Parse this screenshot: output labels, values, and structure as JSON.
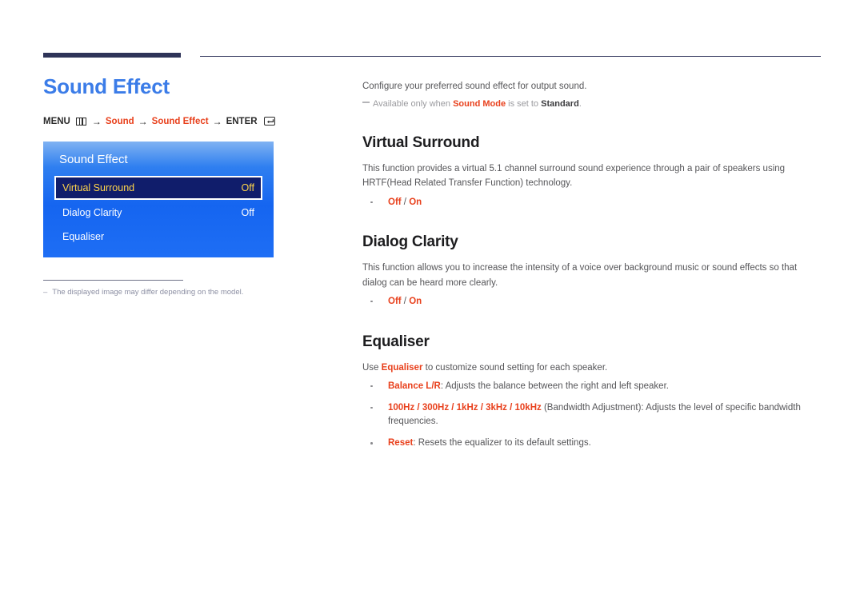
{
  "header": {
    "rule_color": "#2e3458"
  },
  "left": {
    "page_title": "Sound Effect",
    "breadcrumb": {
      "menu_label": "MENU",
      "menu_icon": "menu-grid-icon",
      "arrow": "→",
      "step1": "Sound",
      "step2": "Sound Effect",
      "enter_label": "ENTER",
      "enter_icon": "enter-key-icon"
    },
    "osd": {
      "title": "Sound Effect",
      "rows": [
        {
          "label": "Virtual Surround",
          "value": "Off",
          "selected": true
        },
        {
          "label": "Dialog Clarity",
          "value": "Off",
          "selected": false
        },
        {
          "label": "Equaliser",
          "value": "",
          "selected": false
        }
      ]
    },
    "footnote": {
      "dash": "–",
      "text": "The displayed image may differ depending on the model."
    }
  },
  "right": {
    "intro": "Configure your preferred sound effect for output sound.",
    "note": {
      "prefix": "Available only when ",
      "term1": "Sound Mode",
      "middle": " is set to ",
      "term2": "Standard",
      "suffix": "."
    },
    "sections": [
      {
        "title": "Virtual Surround",
        "body": "This function provides a virtual 5.1 channel surround sound experience through a pair of speakers using HRTF(Head Related Transfer Function) technology.",
        "bullet_off": "Off",
        "bullet_sep": " / ",
        "bullet_on": "On"
      },
      {
        "title": "Dialog Clarity",
        "body": "This function allows you to increase the intensity of a voice over background music or sound effects so that dialog can be heard more clearly.",
        "bullet_off": "Off",
        "bullet_sep": " / ",
        "bullet_on": "On"
      },
      {
        "title": "Equaliser",
        "body_prefix": "Use ",
        "body_term": "Equaliser",
        "body_suffix": " to customize sound setting for each speaker.",
        "items": [
          {
            "term": "Balance L/R",
            "desc": ": Adjusts the balance between the right and left speaker."
          },
          {
            "term": "100Hz / 300Hz / 1kHz / 3kHz / 10kHz",
            "desc": " (Bandwidth Adjustment): Adjusts the level of specific bandwidth frequencies."
          },
          {
            "term": "Reset",
            "desc": ": Resets the equalizer to its default settings."
          }
        ]
      }
    ]
  },
  "colors": {
    "accent_blue": "#3b7ce8",
    "accent_red": "#e8401c",
    "osd_highlight": "#101d6b",
    "osd_highlight_text": "#ffd54a"
  }
}
